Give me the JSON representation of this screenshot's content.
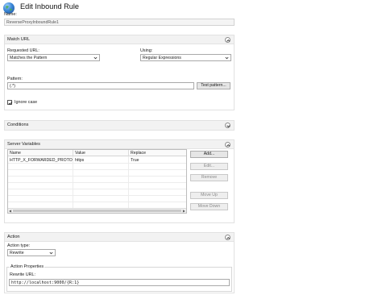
{
  "window": {
    "title": "Edit Inbound Rule"
  },
  "rule": {
    "name_label": "Name:",
    "name_value": "ReverseProxyInboundRule1"
  },
  "match_url": {
    "header": "Match URL",
    "requested_url_label": "Requested URL:",
    "requested_url_value": "Matches the Pattern",
    "using_label": "Using:",
    "using_value": "Regular Expressions",
    "pattern_label": "Pattern:",
    "pattern_value": "(.*)",
    "test_pattern_button": "Test pattern...",
    "ignore_case_label": "Ignore case",
    "ignore_case_checked": true
  },
  "conditions": {
    "header": "Conditions"
  },
  "server_variables": {
    "header": "Server Variables",
    "columns": [
      "Name",
      "Value",
      "Replace"
    ],
    "rows": [
      {
        "name": "HTTP_X_FORWARDED_PROTO",
        "value": "https",
        "replace": "True"
      }
    ],
    "buttons": {
      "add": "Add...",
      "edit": "Edit...",
      "remove": "Remove",
      "move_up": "Move Up",
      "move_down": "Move Down"
    }
  },
  "action": {
    "header": "Action",
    "action_type_label": "Action type:",
    "action_type_value": "Rewrite",
    "properties_label": "Action Properties",
    "rewrite_url_label": "Rewrite URL:",
    "rewrite_url_value": "http://localhost:9000/{R:1}"
  },
  "icons": {
    "app": "globe-icon",
    "collapse": "collapse-chevron-icon",
    "dropdown": "chevron-down-icon",
    "checkbox": "checkmark-icon"
  },
  "colors": {
    "section_header_bg": "#f2f2f2",
    "button_bg": "#e6e6e6",
    "border": "#a9a9a9"
  }
}
